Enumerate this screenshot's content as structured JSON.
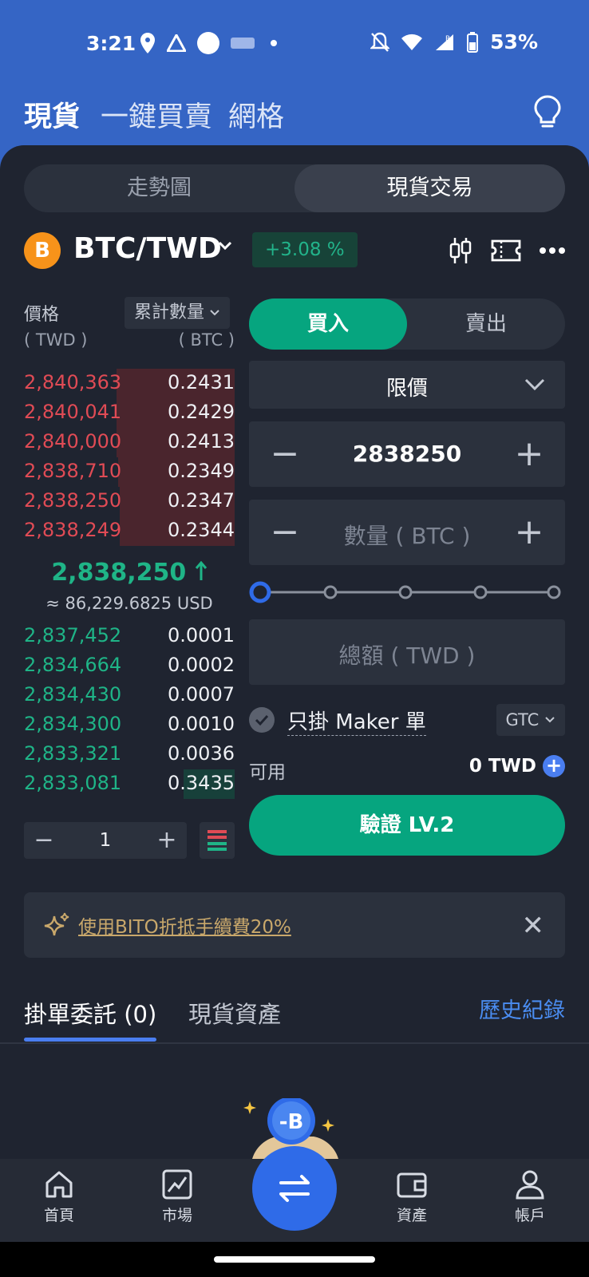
{
  "status_bar": {
    "time": "3:21",
    "battery": "53%"
  },
  "top_nav": {
    "tabs": [
      "現貨",
      "一鍵買賣",
      "網格"
    ],
    "active_index": 0
  },
  "view_toggle": {
    "options": [
      "走勢圖",
      "現貨交易"
    ],
    "active_index": 1
  },
  "pair": {
    "icon_letter": "B",
    "name": "BTC/TWD",
    "change": "+3.08 %"
  },
  "orderbook": {
    "price_label": "價格",
    "price_unit": "( TWD )",
    "qty_select": "累計數量",
    "qty_unit": "( BTC )",
    "asks": [
      {
        "price": "2,840,363",
        "amount": "0.2431"
      },
      {
        "price": "2,840,041",
        "amount": "0.2429"
      },
      {
        "price": "2,840,000",
        "amount": "0.2413"
      },
      {
        "price": "2,838,710",
        "amount": "0.2349"
      },
      {
        "price": "2,838,250",
        "amount": "0.2347"
      },
      {
        "price": "2,838,249",
        "amount": "0.2344"
      }
    ],
    "last_price": "2,838,250",
    "last_price_usd": "≈ 86,229.6825 USD",
    "bids": [
      {
        "price": "2,837,452",
        "amount": "0.0001"
      },
      {
        "price": "2,834,664",
        "amount": "0.0002"
      },
      {
        "price": "2,834,430",
        "amount": "0.0007"
      },
      {
        "price": "2,834,300",
        "amount": "0.0010"
      },
      {
        "price": "2,833,321",
        "amount": "0.0036"
      },
      {
        "price": "2,833,081",
        "amount": "0.3435"
      }
    ],
    "precision_value": "1"
  },
  "order_form": {
    "buy_label": "買入",
    "sell_label": "賣出",
    "active_side": "buy",
    "order_type": "限價",
    "price_value": "2838250",
    "quantity_placeholder": "數量 ( BTC )",
    "total_placeholder": "總額 ( TWD )",
    "slider_percent": 0,
    "maker_label": "只掛 Maker 單",
    "tif": "GTC",
    "available_label": "可用",
    "available_value": "0 TWD",
    "verify_button": "驗證 LV.2"
  },
  "promo": {
    "text": "使用BITO折抵手續費20%"
  },
  "orders_tabs": {
    "open_orders": "掛單委託 (0)",
    "spot_assets": "現貨資產",
    "history": "歷史紀錄"
  },
  "mascot_letter": "-B",
  "bottom_nav": {
    "items": [
      "首頁",
      "市場",
      "資產",
      "帳戶"
    ]
  },
  "colors": {
    "brand_blue": "#3565c5",
    "buy_green": "#06a57f",
    "ask_red": "#e04b55",
    "bid_green": "#1fb487",
    "panel_bg": "#1f2430"
  }
}
